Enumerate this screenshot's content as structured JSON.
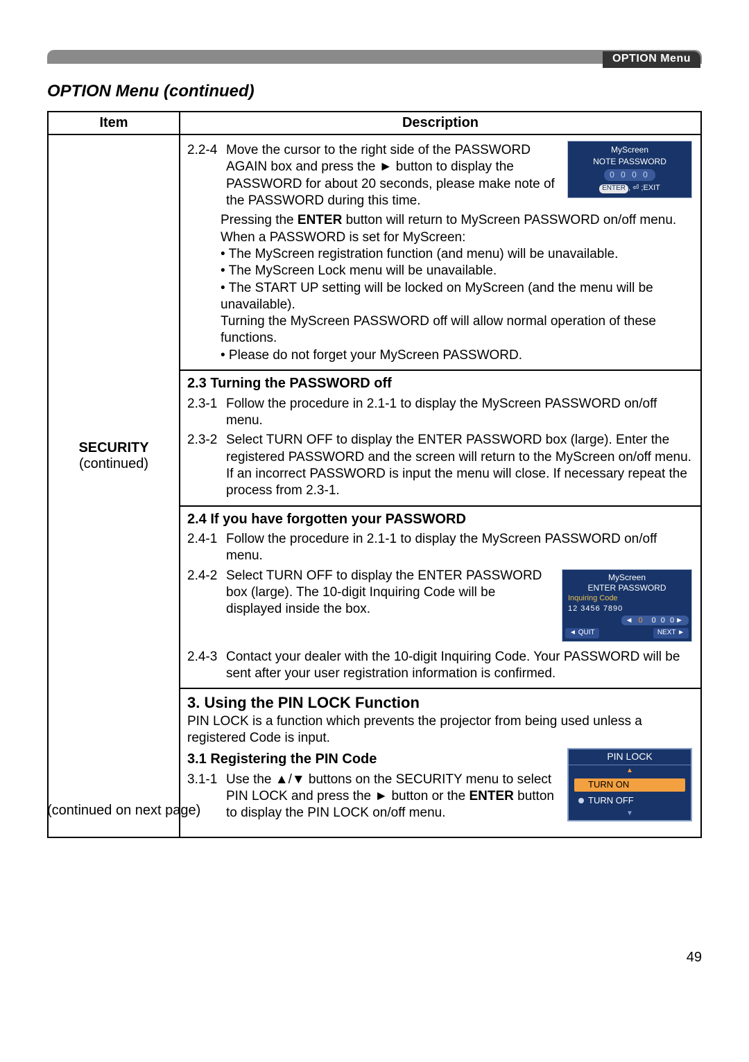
{
  "header_tab": "OPTION Menu",
  "page_title": "OPTION Menu (continued)",
  "table": {
    "headers": {
      "item": "Item",
      "description": "Description"
    },
    "item_label": "SECURITY",
    "item_sub": "(continued)"
  },
  "s224": {
    "num": "2.2-4",
    "text1": "Move the cursor to the right side of the PASSWORD AGAIN box and press the ► button to display the PASSWORD for about 20 seconds, please make note of the PASSWORD during this time.",
    "text2": "Pressing the ENTER button will return to MyScreen PASSWORD on/off menu.",
    "when": "When a PASSWORD is set for MyScreen:",
    "bul1": "• The MyScreen registration function (and menu) will be unavailable.",
    "bul2": "• The MyScreen Lock menu will be unavailable.",
    "bul3": "• The START UP setting will be locked on MyScreen (and the menu will be unavailable).",
    "turnoff": "Turning the MyScreen PASSWORD off will allow normal operation of these functions.",
    "bul4": "• Please do not forget your MyScreen PASSWORD."
  },
  "osd_note": {
    "title": "MyScreen",
    "sub": "NOTE PASSWORD",
    "digits": "0 0 0 0",
    "enter_label": "ENTER",
    "exit_label": "EXIT"
  },
  "s23": {
    "head": "2.3 Turning the PASSWORD off",
    "p1n": "2.3-1",
    "p1": "Follow the procedure in 2.1-1 to display the MyScreen PASSWORD on/off menu.",
    "p2n": "2.3-2",
    "p2": "Select TURN OFF to display the ENTER PASSWORD box (large). Enter the registered PASSWORD and the screen will return to the MyScreen on/off menu.",
    "p2b": "If an incorrect PASSWORD is input the menu will close. If necessary repeat the process from 2.3-1."
  },
  "s24": {
    "head": "2.4 If you have forgotten your PASSWORD",
    "p1n": "2.4-1",
    "p1": "Follow the procedure in 2.1-1 to display the MyScreen PASSWORD on/off menu.",
    "p2n": "2.4-2",
    "p2": "Select TURN OFF to display the ENTER PASSWORD box (large). The 10-digit Inquiring Code will be displayed inside the box.",
    "p3n": "2.4-3",
    "p3": "Contact your dealer with the 10-digit Inquiring Code. Your PASSWORD will be sent after your user registration information is confirmed."
  },
  "osd_enter": {
    "title": "MyScreen",
    "sub": "ENTER PASSWORD",
    "iq_label": "Inquiring Code",
    "iq_code": "12 3456 7890",
    "entry": "0 0 0 0",
    "quit": "QUIT",
    "next": "NEXT"
  },
  "s3": {
    "head": "3. Using the PIN LOCK Function",
    "intro": "PIN LOCK is a function which prevents the projector from being used unless a registered Code is input.",
    "sub": "3.1 Registering the PIN Code",
    "p1n": "3.1-1",
    "p1": "Use the ▲/▼ buttons on the SECURITY menu to select PIN LOCK and press the ► button or the ENTER button to display the PIN LOCK on/off menu."
  },
  "osd_pin": {
    "title": "PIN LOCK",
    "on": "TURN ON",
    "off": "TURN OFF"
  },
  "footer": {
    "continued": "(continued on next page)",
    "page": "49"
  }
}
